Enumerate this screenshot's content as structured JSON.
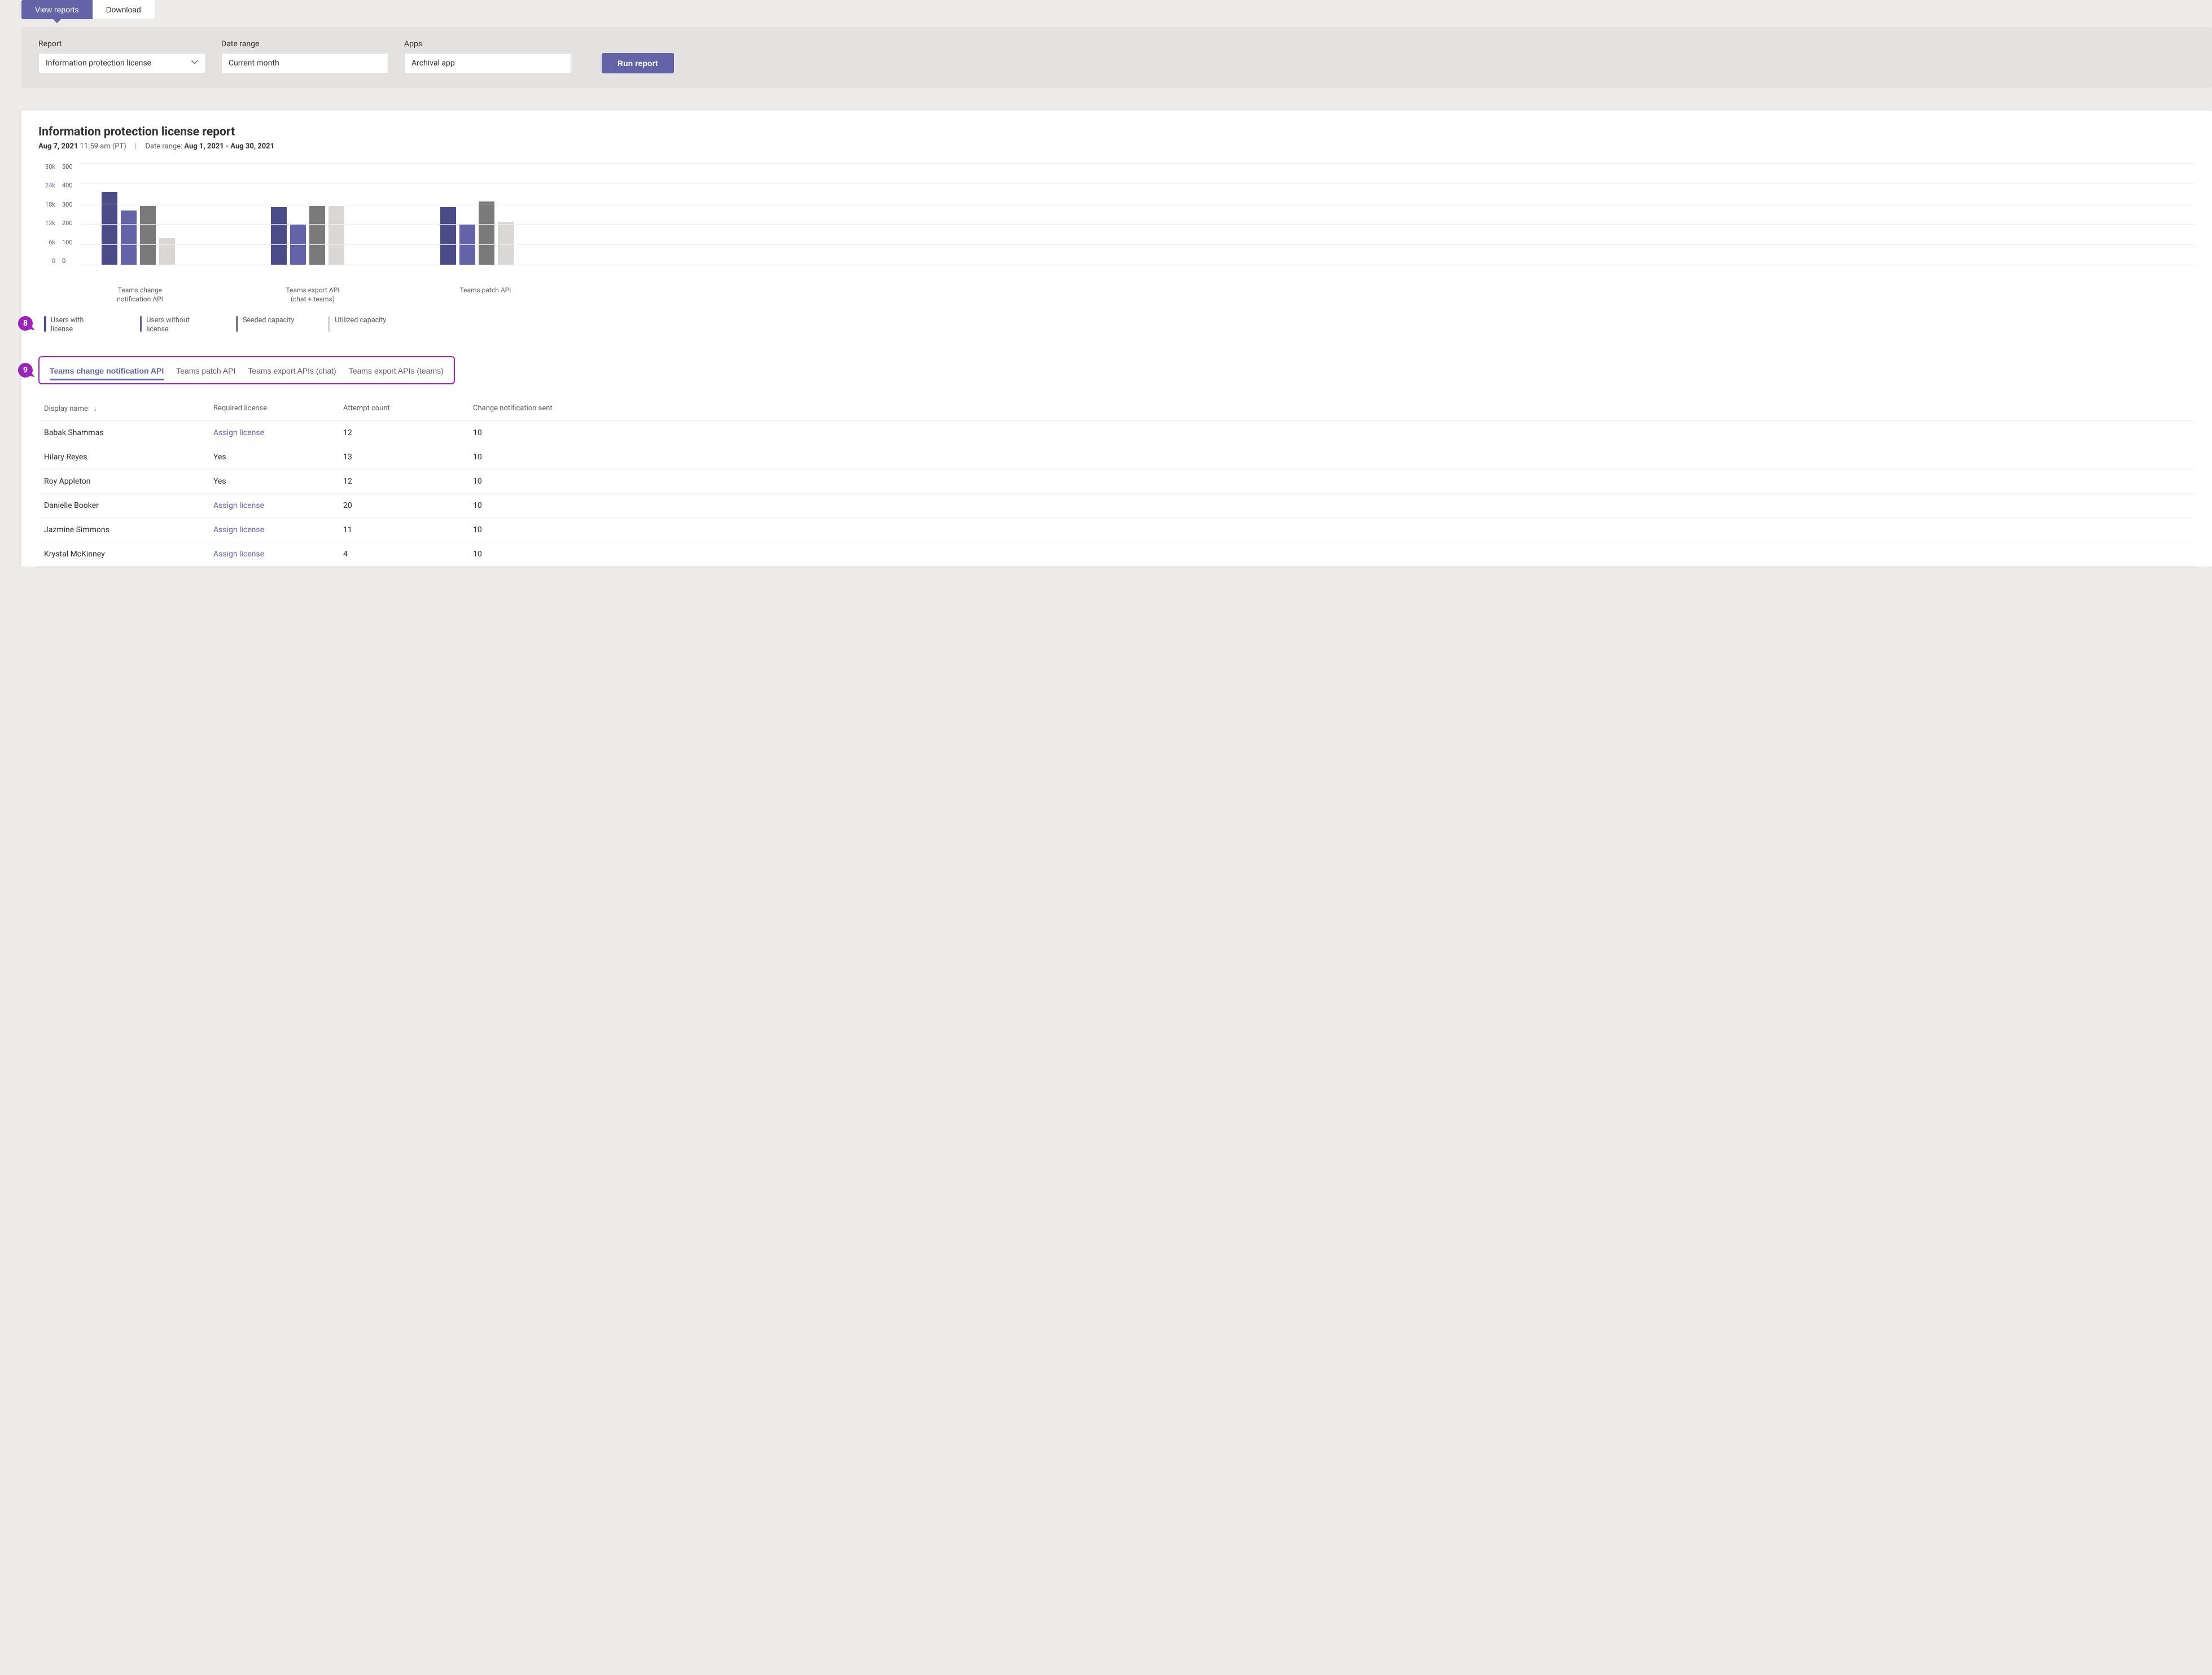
{
  "top_tabs": {
    "view_reports": "View reports",
    "download": "Download"
  },
  "config": {
    "report_label": "Report",
    "report_value": "Information protection license",
    "date_label": "Date range",
    "date_value": "Current month",
    "apps_label": "Apps",
    "apps_value": "Archival app",
    "run_label": "Run report"
  },
  "report": {
    "title": "Information protection license report",
    "timestamp_bold": "Aug 7, 2021",
    "timestamp_rest": " 11:59 am (PT)",
    "date_range_prefix": "Date range: ",
    "date_range_value": "Aug 1, 2021 - Aug 30, 2021"
  },
  "legend": {
    "a": "Users with license",
    "b": "Users without license",
    "c": "Seeded capacity",
    "d": "Utilized capacity"
  },
  "callouts": {
    "eight": "8",
    "nine": "9"
  },
  "chart_data": {
    "type": "bar",
    "left_axis": {
      "label": "",
      "ticks": [
        "30k",
        "24k",
        "18k",
        "12k",
        "6k",
        "0"
      ],
      "max": 30000
    },
    "right_axis": {
      "label": "",
      "ticks": [
        "500",
        "400",
        "300",
        "200",
        "100",
        "0"
      ],
      "max": 500
    },
    "categories": [
      "Teams change notification API",
      "Teams export API\n(chat + teams)",
      "Teams patch API"
    ],
    "series": [
      {
        "name": "Users with license",
        "axis": "left",
        "color": "#4A4C87",
        "values": [
          21500,
          17000,
          17000
        ]
      },
      {
        "name": "Users without license",
        "axis": "left",
        "color": "#6264A7",
        "values": [
          16000,
          12000,
          12000
        ]
      },
      {
        "name": "Seeded capacity",
        "axis": "right",
        "color": "#7A7A7A",
        "values": [
          290,
          290,
          310
        ]
      },
      {
        "name": "Utilized capacity",
        "axis": "right",
        "color": "#D9D7D5",
        "values": [
          130,
          290,
          210
        ]
      }
    ]
  },
  "api_tabs": [
    "Teams change notification API",
    "Teams patch API",
    "Teams export APIs (chat)",
    "Teams export APIs (teams)"
  ],
  "table": {
    "columns": {
      "display_name": "Display name",
      "required_license": "Required license",
      "attempt_count": "Attempt count",
      "change_notification_sent": "Change notification sent"
    },
    "assign_license_label": "Assign license",
    "yes_label": "Yes",
    "rows": [
      {
        "name": "Babak Shammas",
        "license": "assign",
        "attempt": "12",
        "sent": "10"
      },
      {
        "name": "Hilary Reyes",
        "license": "yes",
        "attempt": "13",
        "sent": "10"
      },
      {
        "name": "Roy Appleton",
        "license": "yes",
        "attempt": "12",
        "sent": "10"
      },
      {
        "name": "Danielle Booker",
        "license": "assign",
        "attempt": "20",
        "sent": "10"
      },
      {
        "name": "Jazmine Simmons",
        "license": "assign",
        "attempt": "11",
        "sent": "10"
      },
      {
        "name": "Krystal McKinney",
        "license": "assign",
        "attempt": "4",
        "sent": "10"
      }
    ]
  }
}
